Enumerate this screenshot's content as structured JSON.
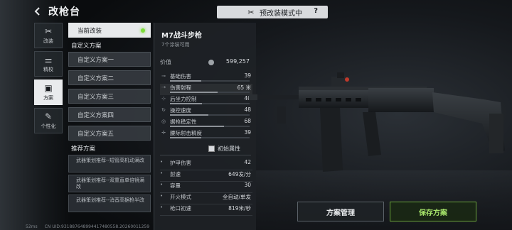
{
  "header": {
    "title": "改枪台"
  },
  "mode": {
    "label": "预改装模式中",
    "help": "?"
  },
  "rail": [
    {
      "label": "改装",
      "icon": "wrench-icon",
      "glyph": "✂",
      "active": false
    },
    {
      "label": "精校",
      "icon": "sliders-icon",
      "glyph": "⚌",
      "active": false
    },
    {
      "label": "方案",
      "icon": "scheme-icon",
      "glyph": "▣",
      "active": true
    },
    {
      "label": "个性化",
      "icon": "personalize-icon",
      "glyph": "✎",
      "active": false
    }
  ],
  "presets": {
    "current": "当前改装",
    "custom_title": "自定义方案",
    "custom": [
      "自定义方案一",
      "自定义方案二",
      "自定义方案三",
      "自定义方案四",
      "自定义方案五"
    ],
    "rec_title": "推荐方案",
    "recommended": [
      "武器策划推荐--短管高机动满改",
      "武器策划推荐--双重直单倍镜满改",
      "武器策划推荐--消音高据枪半改"
    ]
  },
  "weapon": {
    "name": "M7战斗步枪",
    "skins": "7个涂装可用",
    "value_label": "价值",
    "value": "599,257",
    "stats": [
      {
        "name": "基础伤害",
        "value": "39",
        "pct": 0.39
      },
      {
        "name": "伤害射程",
        "value": "65 米",
        "pct": 0.6
      },
      {
        "name": "后坐力控制",
        "value": "40",
        "pct": 0.4
      },
      {
        "name": "操控速度",
        "value": "48",
        "pct": 0.48
      },
      {
        "name": "据枪稳定性",
        "value": "68",
        "pct": 0.68
      },
      {
        "name": "腰际射击精度",
        "value": "39",
        "pct": 0.39
      }
    ],
    "initial_label": "初始属性",
    "attrs": [
      {
        "name": "护甲伤害",
        "value": "42"
      },
      {
        "name": "射速",
        "value": "649发/分"
      },
      {
        "name": "容量",
        "value": "30"
      },
      {
        "name": "开火模式",
        "value": "全自动/单发"
      },
      {
        "name": "枪口初速",
        "value": "819米/秒"
      }
    ]
  },
  "buttons": {
    "manage": "方案管理",
    "save": "保存方案"
  },
  "status": {
    "ping": "52ms",
    "uid": "CN UID:931887648994417480558.20260011259"
  },
  "colors": {
    "accent_green": "#7ddc3a",
    "save_text": "#a6e36a"
  }
}
